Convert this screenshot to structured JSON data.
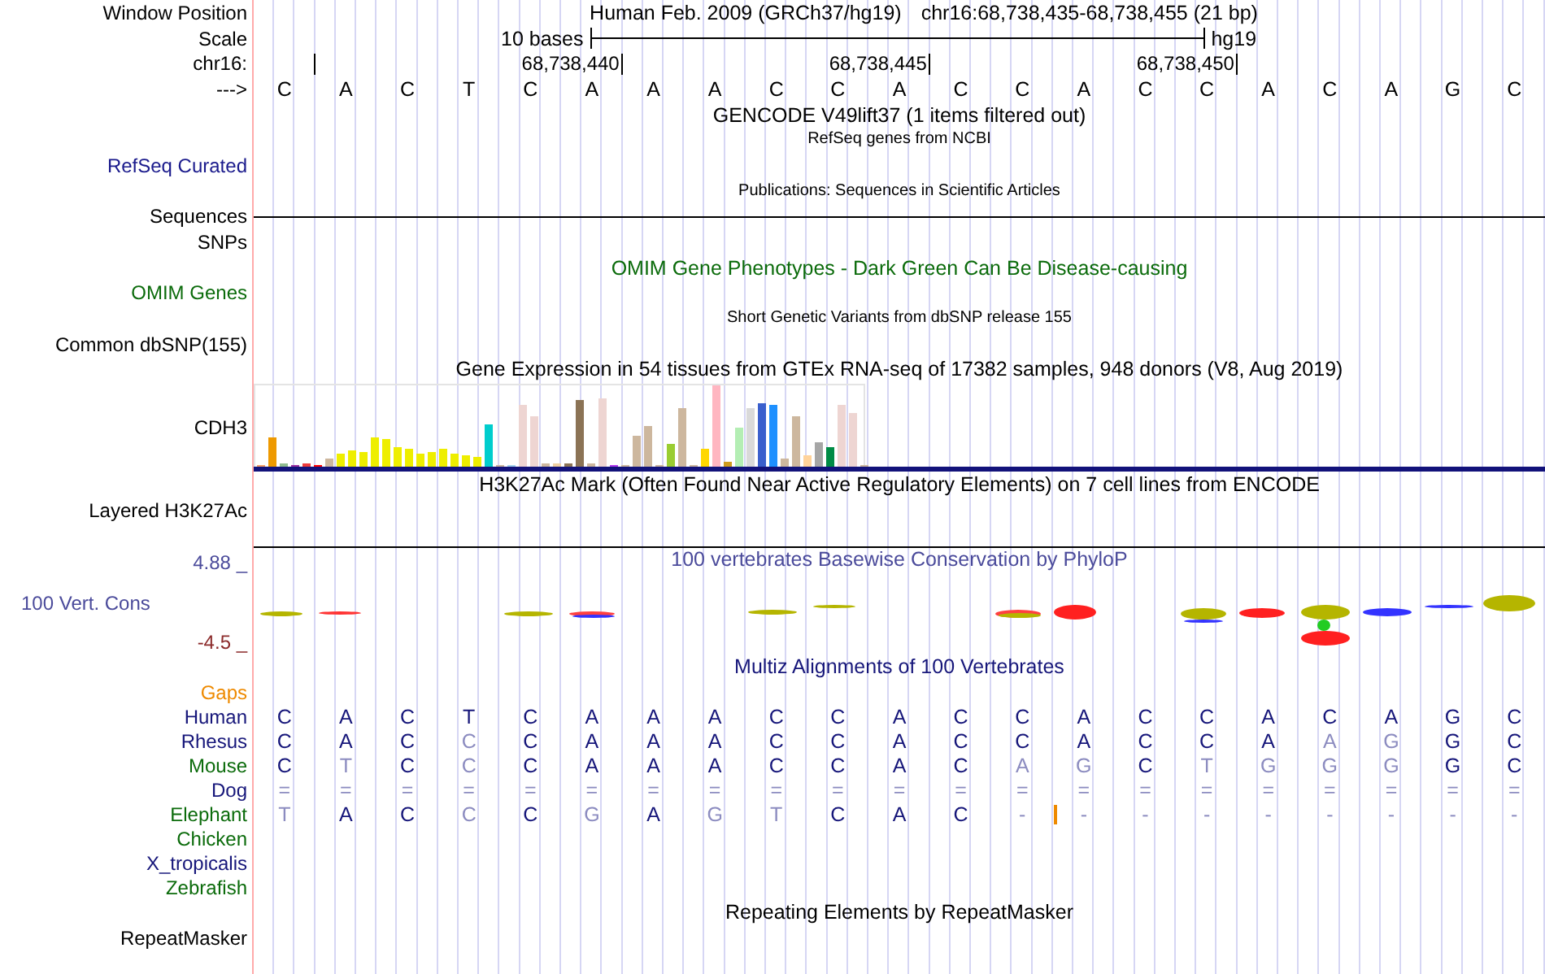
{
  "position": {
    "label": "Window Position",
    "assembly": "Human Feb. 2009 (GRCh37/hg19)",
    "range": "chr16:68,738,435-68,738,455 (21 bp)"
  },
  "scale": {
    "label": "Scale",
    "length": "10 bases",
    "assembly": "hg19"
  },
  "ruler": {
    "label": "chr16:",
    "ticks": [
      "68,738,440",
      "68,738,445",
      "68,738,450"
    ]
  },
  "sequence": {
    "label": "--->",
    "bases": [
      "C",
      "A",
      "C",
      "T",
      "C",
      "A",
      "A",
      "A",
      "C",
      "C",
      "A",
      "C",
      "C",
      "A",
      "C",
      "C",
      "A",
      "C",
      "A",
      "G",
      "C"
    ]
  },
  "tracks": [
    {
      "kind": "title",
      "text": "GENCODE V49lift37 (1 items filtered out)",
      "color": "#000000"
    },
    {
      "kind": "note",
      "text": "RefSeq genes from NCBI"
    },
    {
      "kind": "label",
      "label": "RefSeq Curated",
      "color": "#1a1a8c"
    },
    {
      "kind": "note",
      "text": "Publications: Sequences in Scientific Articles"
    },
    {
      "kind": "line",
      "label": "Sequences",
      "color": "#000000"
    },
    {
      "kind": "label",
      "label": "SNPs",
      "color": "#000000"
    },
    {
      "kind": "title",
      "text": "OMIM Gene Phenotypes - Dark Green Can Be Disease-causing",
      "color": "#0b6b0b"
    },
    {
      "kind": "label",
      "label": "OMIM Genes",
      "color": "#0b6b0b"
    },
    {
      "kind": "note",
      "text": "Short Genetic Variants from dbSNP release 155"
    },
    {
      "kind": "label",
      "label": "Common dbSNP(155)",
      "color": "#000000"
    },
    {
      "kind": "title",
      "text": "Gene Expression in 54 tissues from GTEx RNA-seq of 17382 samples, 948 donors (V8, Aug 2019)",
      "color": "#000000"
    },
    {
      "kind": "expression",
      "label": "CDH3"
    },
    {
      "kind": "title",
      "text": "H3K27Ac Mark (Often Found Near Active Regulatory Elements) on 7 cell lines from ENCODE",
      "color": "#000000"
    },
    {
      "kind": "label",
      "label": "Layered H3K27Ac",
      "color": "#000000"
    },
    {
      "kind": "rule"
    },
    {
      "kind": "conservation",
      "label": "100 Vert. Cons",
      "title": "100 vertebrates Basewise Conservation by PhyloP",
      "max": "4.88 _",
      "min": "-4.5 _",
      "color": "#4b4b9b"
    },
    {
      "kind": "title",
      "text": "Multiz Alignments of 100 Vertebrates",
      "color": "#16167a"
    },
    {
      "kind": "alignment",
      "gaps": {
        "label": "Gaps",
        "color": "#ee8a00"
      },
      "species": [
        {
          "name": "Human",
          "color": "#16167a",
          "bases": [
            {
              "base": "C",
              "dim": false
            },
            {
              "base": "A",
              "dim": false
            },
            {
              "base": "C",
              "dim": false
            },
            {
              "base": "T",
              "dim": false
            },
            {
              "base": "C",
              "dim": false
            },
            {
              "base": "A",
              "dim": false
            },
            {
              "base": "A",
              "dim": false
            },
            {
              "base": "A",
              "dim": false
            },
            {
              "base": "C",
              "dim": false
            },
            {
              "base": "C",
              "dim": false
            },
            {
              "base": "A",
              "dim": false
            },
            {
              "base": "C",
              "dim": false
            },
            {
              "base": "C",
              "dim": false
            },
            {
              "base": "A",
              "dim": false
            },
            {
              "base": "C",
              "dim": false
            },
            {
              "base": "C",
              "dim": false
            },
            {
              "base": "A",
              "dim": false
            },
            {
              "base": "C",
              "dim": false
            },
            {
              "base": "A",
              "dim": false
            },
            {
              "base": "G",
              "dim": false
            },
            {
              "base": "C",
              "dim": false
            }
          ]
        },
        {
          "name": "Rhesus",
          "color": "#16167a",
          "bases": [
            {
              "base": "C",
              "dim": false
            },
            {
              "base": "A",
              "dim": false
            },
            {
              "base": "C",
              "dim": false
            },
            {
              "base": "C",
              "dim": true
            },
            {
              "base": "C",
              "dim": false
            },
            {
              "base": "A",
              "dim": false
            },
            {
              "base": "A",
              "dim": false
            },
            {
              "base": "A",
              "dim": false
            },
            {
              "base": "C",
              "dim": false
            },
            {
              "base": "C",
              "dim": false
            },
            {
              "base": "A",
              "dim": false
            },
            {
              "base": "C",
              "dim": false
            },
            {
              "base": "C",
              "dim": false
            },
            {
              "base": "A",
              "dim": false
            },
            {
              "base": "C",
              "dim": false
            },
            {
              "base": "C",
              "dim": false
            },
            {
              "base": "A",
              "dim": false
            },
            {
              "base": "A",
              "dim": true
            },
            {
              "base": "G",
              "dim": true
            },
            {
              "base": "G",
              "dim": false
            },
            {
              "base": "C",
              "dim": false
            }
          ]
        },
        {
          "name": "Mouse",
          "color": "#0b6b0b",
          "bases": [
            {
              "base": "C",
              "dim": false
            },
            {
              "base": "T",
              "dim": true
            },
            {
              "base": "C",
              "dim": false
            },
            {
              "base": "C",
              "dim": true
            },
            {
              "base": "C",
              "dim": false
            },
            {
              "base": "A",
              "dim": false
            },
            {
              "base": "A",
              "dim": false
            },
            {
              "base": "A",
              "dim": false
            },
            {
              "base": "C",
              "dim": false
            },
            {
              "base": "C",
              "dim": false
            },
            {
              "base": "A",
              "dim": false
            },
            {
              "base": "C",
              "dim": false
            },
            {
              "base": "A",
              "dim": true
            },
            {
              "base": "G",
              "dim": true
            },
            {
              "base": "C",
              "dim": false
            },
            {
              "base": "T",
              "dim": true
            },
            {
              "base": "G",
              "dim": true
            },
            {
              "base": "G",
              "dim": true
            },
            {
              "base": "G",
              "dim": true
            },
            {
              "base": "G",
              "dim": false
            },
            {
              "base": "C",
              "dim": false
            }
          ]
        },
        {
          "name": "Dog",
          "color": "#16167a",
          "bases": [
            {
              "base": "=",
              "dim": true
            },
            {
              "base": "=",
              "dim": true
            },
            {
              "base": "=",
              "dim": true
            },
            {
              "base": "=",
              "dim": true
            },
            {
              "base": "=",
              "dim": true
            },
            {
              "base": "=",
              "dim": true
            },
            {
              "base": "=",
              "dim": true
            },
            {
              "base": "=",
              "dim": true
            },
            {
              "base": "=",
              "dim": true
            },
            {
              "base": "=",
              "dim": true
            },
            {
              "base": "=",
              "dim": true
            },
            {
              "base": "=",
              "dim": true
            },
            {
              "base": "=",
              "dim": true
            },
            {
              "base": "=",
              "dim": true
            },
            {
              "base": "=",
              "dim": true
            },
            {
              "base": "=",
              "dim": true
            },
            {
              "base": "=",
              "dim": true
            },
            {
              "base": "=",
              "dim": true
            },
            {
              "base": "=",
              "dim": true
            },
            {
              "base": "=",
              "dim": true
            },
            {
              "base": "=",
              "dim": true
            }
          ]
        },
        {
          "name": "Elephant",
          "color": "#0b6b0b",
          "bases": [
            {
              "base": "T",
              "dim": true
            },
            {
              "base": "A",
              "dim": false
            },
            {
              "base": "C",
              "dim": false
            },
            {
              "base": "C",
              "dim": true
            },
            {
              "base": "C",
              "dim": false
            },
            {
              "base": "G",
              "dim": true
            },
            {
              "base": "A",
              "dim": false
            },
            {
              "base": "G",
              "dim": true
            },
            {
              "base": "T",
              "dim": true
            },
            {
              "base": "C",
              "dim": false
            },
            {
              "base": "A",
              "dim": false
            },
            {
              "base": "C",
              "dim": false
            },
            {
              "base": "-",
              "dim": true,
              "insert": true
            },
            {
              "base": "-",
              "dim": true
            },
            {
              "base": "-",
              "dim": true
            },
            {
              "base": "-",
              "dim": true
            },
            {
              "base": "-",
              "dim": true
            },
            {
              "base": "-",
              "dim": true
            },
            {
              "base": "-",
              "dim": true
            },
            {
              "base": "-",
              "dim": true
            },
            {
              "base": "-",
              "dim": true
            }
          ]
        },
        {
          "name": "Chicken",
          "color": "#0b6b0b"
        },
        {
          "name": "X_tropicalis",
          "color": "#16167a"
        },
        {
          "name": "Zebrafish",
          "color": "#0b6b0b"
        }
      ]
    },
    {
      "kind": "title",
      "text": "Repeating Elements by RepeatMasker",
      "color": "#000000"
    },
    {
      "kind": "label",
      "label": "RepeatMasker",
      "color": "#000000"
    }
  ]
}
